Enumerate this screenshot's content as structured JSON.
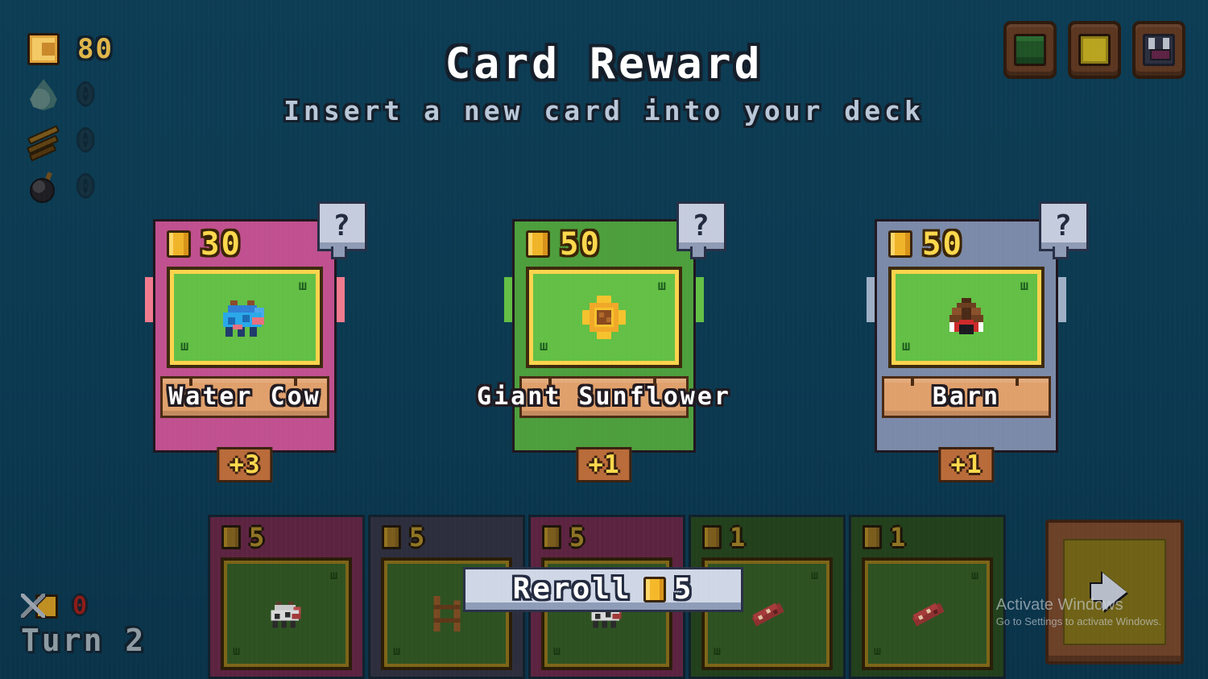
{
  "header": {
    "title": "Card Reward",
    "subtitle": "Insert a new card into your deck"
  },
  "colors": {
    "background": "#0b3a50",
    "title_text": "#ffffff",
    "subtitle_text": "#b9c7d8",
    "gold": "#ffd84d",
    "card_pink": "#c0508f",
    "card_green": "#4d9e3d",
    "card_slate": "#7b8aa8",
    "nameplate": "#e0a06b",
    "field_green": "#63bf45",
    "reroll_bg": "#cfd7e6",
    "endturn_frame": "#6b4127",
    "endturn_panel": "#6f6216"
  },
  "resources": [
    {
      "name": "gold",
      "icon": "gold-bar-icon",
      "value": "80",
      "dim": false
    },
    {
      "name": "water",
      "icon": "water-drop-icon",
      "value": "0",
      "dim": true
    },
    {
      "name": "wood",
      "icon": "wood-planks-icon",
      "value": "0",
      "dim": true
    },
    {
      "name": "bomb",
      "icon": "bomb-icon",
      "value": "0",
      "dim": true
    }
  ],
  "status": {
    "tool_icon": "wrench-gold-icon",
    "tool_value": "0",
    "turn_label": "Turn 2"
  },
  "top_buttons": [
    {
      "name": "deck-book-button",
      "icon": "green-book-icon"
    },
    {
      "name": "gold-item-button",
      "icon": "gold-ingot-icon"
    },
    {
      "name": "potion-button",
      "icon": "potion-flask-icon"
    }
  ],
  "reward_cards": [
    {
      "id": "water-cow",
      "name": "Water Cow",
      "cost": "30",
      "bonus": "+3",
      "frame_color": "#c0508f",
      "shadow_color": "#f07a8e",
      "sprite": "blue-cow-sprite",
      "info_label": "?"
    },
    {
      "id": "giant-sunflower",
      "name": "Giant Sunflower",
      "cost": "50",
      "bonus": "+1",
      "frame_color": "#4d9e3d",
      "shadow_color": "#63bf45",
      "sprite": "sunflower-sprite",
      "info_label": "?"
    },
    {
      "id": "barn",
      "name": "Barn",
      "cost": "50",
      "bonus": "+1",
      "frame_color": "#7b8aa8",
      "shadow_color": "#9fb0c6",
      "sprite": "barn-sprite",
      "info_label": "?"
    }
  ],
  "reroll": {
    "label": "Reroll",
    "cost": "5",
    "coin_icon": "gold-coin-icon"
  },
  "deck_cards": [
    {
      "id": "deck-cow-1",
      "cost": "5",
      "frame_color": "#5c2340",
      "sprite": "cow-sprite"
    },
    {
      "id": "deck-fence",
      "cost": "5",
      "frame_color": "#2d2e3d",
      "sprite": "fence-sprite"
    },
    {
      "id": "deck-cow-2",
      "cost": "5",
      "frame_color": "#5c2340",
      "sprite": "cow-sprite"
    },
    {
      "id": "deck-crop-1",
      "cost": "1",
      "frame_color": "#22401c",
      "sprite": "crop-sprite"
    },
    {
      "id": "deck-crop-2",
      "cost": "1",
      "frame_color": "#22401c",
      "sprite": "crop-sprite"
    }
  ],
  "end_turn": {
    "name": "end-turn-button",
    "icon": "right-arrow-icon"
  },
  "watermark": {
    "line1": "Activate Windows",
    "line2": "Go to Settings to activate Windows."
  },
  "grass_tuft": "ш"
}
